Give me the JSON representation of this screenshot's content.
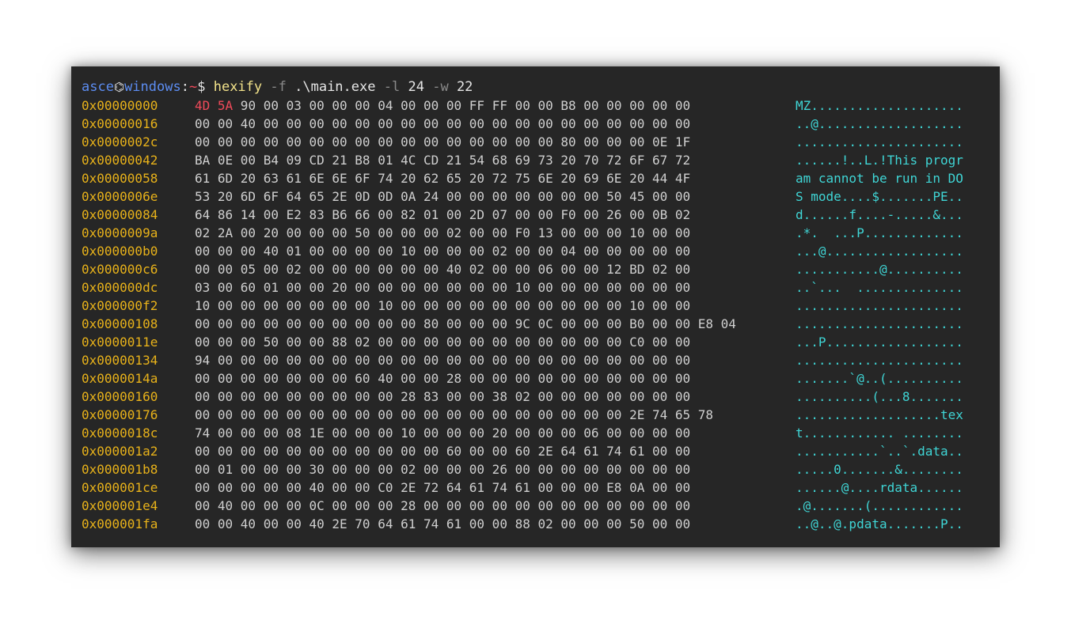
{
  "window": {
    "prompt": {
      "user": "asce",
      "at_symbol": "⌬",
      "host": "windows",
      "colon": ":",
      "path": "~",
      "dollar": "$",
      "command": "hexify",
      "flag_f": "-f",
      "file": ".\\main.exe",
      "flag_l": "-l",
      "lines": "24",
      "flag_w": "-w",
      "width": "22"
    },
    "colors": {
      "background": "#262626",
      "offset": "#e8b21a",
      "hex": "#cfcfcf",
      "ascii": "#3fd5d5",
      "highlight": "#f04a5a",
      "user": "#5c8df2",
      "command": "#f2e28a"
    },
    "rows": [
      {
        "offset": "0x00000000",
        "hex_hi": "4D 5A",
        "hex": " 90 00 03 00 00 00 04 00 00 00 FF FF 00 00 B8 00 00 00 00 00",
        "ascii": "MZ...................."
      },
      {
        "offset": "0x00000016",
        "hex_hi": "",
        "hex": "00 00 40 00 00 00 00 00 00 00 00 00 00 00 00 00 00 00 00 00 00 00",
        "ascii": "..@..................."
      },
      {
        "offset": "0x0000002c",
        "hex_hi": "",
        "hex": "00 00 00 00 00 00 00 00 00 00 00 00 00 00 00 00 80 00 00 00 0E 1F",
        "ascii": "......................"
      },
      {
        "offset": "0x00000042",
        "hex_hi": "",
        "hex": "BA 0E 00 B4 09 CD 21 B8 01 4C CD 21 54 68 69 73 20 70 72 6F 67 72",
        "ascii": "......!..L.!This progr"
      },
      {
        "offset": "0x00000058",
        "hex_hi": "",
        "hex": "61 6D 20 63 61 6E 6E 6F 74 20 62 65 20 72 75 6E 20 69 6E 20 44 4F",
        "ascii": "am cannot be run in DO"
      },
      {
        "offset": "0x0000006e",
        "hex_hi": "",
        "hex": "53 20 6D 6F 64 65 2E 0D 0D 0A 24 00 00 00 00 00 00 00 50 45 00 00",
        "ascii": "S mode....$.......PE.."
      },
      {
        "offset": "0x00000084",
        "hex_hi": "",
        "hex": "64 86 14 00 E2 83 B6 66 00 82 01 00 2D 07 00 00 F0 00 26 00 0B 02",
        "ascii": "d......f....-.....&..."
      },
      {
        "offset": "0x0000009a",
        "hex_hi": "",
        "hex": "02 2A 00 20 00 00 00 50 00 00 00 02 00 00 F0 13 00 00 00 10 00 00",
        "ascii": ".*.  ...P............."
      },
      {
        "offset": "0x000000b0",
        "hex_hi": "",
        "hex": "00 00 00 40 01 00 00 00 00 10 00 00 00 02 00 00 04 00 00 00 00 00",
        "ascii": "...@.................."
      },
      {
        "offset": "0x000000c6",
        "hex_hi": "",
        "hex": "00 00 05 00 02 00 00 00 00 00 00 40 02 00 00 06 00 00 12 BD 02 00",
        "ascii": "...........@.........."
      },
      {
        "offset": "0x000000dc",
        "hex_hi": "",
        "hex": "03 00 60 01 00 00 20 00 00 00 00 00 00 00 10 00 00 00 00 00 00 00",
        "ascii": "..`...  .............."
      },
      {
        "offset": "0x000000f2",
        "hex_hi": "",
        "hex": "10 00 00 00 00 00 00 00 10 00 00 00 00 00 00 00 00 00 00 10 00 00",
        "ascii": "......................"
      },
      {
        "offset": "0x00000108",
        "hex_hi": "",
        "hex": "00 00 00 00 00 00 00 00 00 00 80 00 00 00 9C 0C 00 00 00 B0 00 00 E8 04",
        "ascii": "......................"
      },
      {
        "offset": "0x0000011e",
        "hex_hi": "",
        "hex": "00 00 00 50 00 00 88 02 00 00 00 00 00 00 00 00 00 00 00 C0 00 00",
        "ascii": "...P.................."
      },
      {
        "offset": "0x00000134",
        "hex_hi": "",
        "hex": "94 00 00 00 00 00 00 00 00 00 00 00 00 00 00 00 00 00 00 00 00 00",
        "ascii": "......................"
      },
      {
        "offset": "0x0000014a",
        "hex_hi": "",
        "hex": "00 00 00 00 00 00 00 60 40 00 00 28 00 00 00 00 00 00 00 00 00 00",
        "ascii": ".......`@..(.........."
      },
      {
        "offset": "0x00000160",
        "hex_hi": "",
        "hex": "00 00 00 00 00 00 00 00 00 28 83 00 00 38 02 00 00 00 00 00 00 00",
        "ascii": "..........(...8......."
      },
      {
        "offset": "0x00000176",
        "hex_hi": "",
        "hex": "00 00 00 00 00 00 00 00 00 00 00 00 00 00 00 00 00 00 00 2E 74 65 78",
        "ascii": "...................tex"
      },
      {
        "offset": "0x0000018c",
        "hex_hi": "",
        "hex": "74 00 00 00 08 1E 00 00 00 10 00 00 00 20 00 00 00 06 00 00 00 00",
        "ascii": "t............ ........"
      },
      {
        "offset": "0x000001a2",
        "hex_hi": "",
        "hex": "00 00 00 00 00 00 00 00 00 00 00 60 00 00 60 2E 64 61 74 61 00 00",
        "ascii": "...........`..`.data.."
      },
      {
        "offset": "0x000001b8",
        "hex_hi": "",
        "hex": "00 01 00 00 00 30 00 00 00 02 00 00 00 26 00 00 00 00 00 00 00 00",
        "ascii": ".....0.......&........"
      },
      {
        "offset": "0x000001ce",
        "hex_hi": "",
        "hex": "00 00 00 00 00 40 00 00 C0 2E 72 64 61 74 61 00 00 00 E8 0A 00 00",
        "ascii": "......@....rdata......"
      },
      {
        "offset": "0x000001e4",
        "hex_hi": "",
        "hex": "00 40 00 00 00 0C 00 00 00 28 00 00 00 00 00 00 00 00 00 00 00 00",
        "ascii": ".@.......(............"
      },
      {
        "offset": "0x000001fa",
        "hex_hi": "",
        "hex": "00 00 40 00 00 40 2E 70 64 61 74 61 00 00 88 02 00 00 00 50 00 00",
        "ascii": "..@..@.pdata.......P.."
      }
    ]
  }
}
